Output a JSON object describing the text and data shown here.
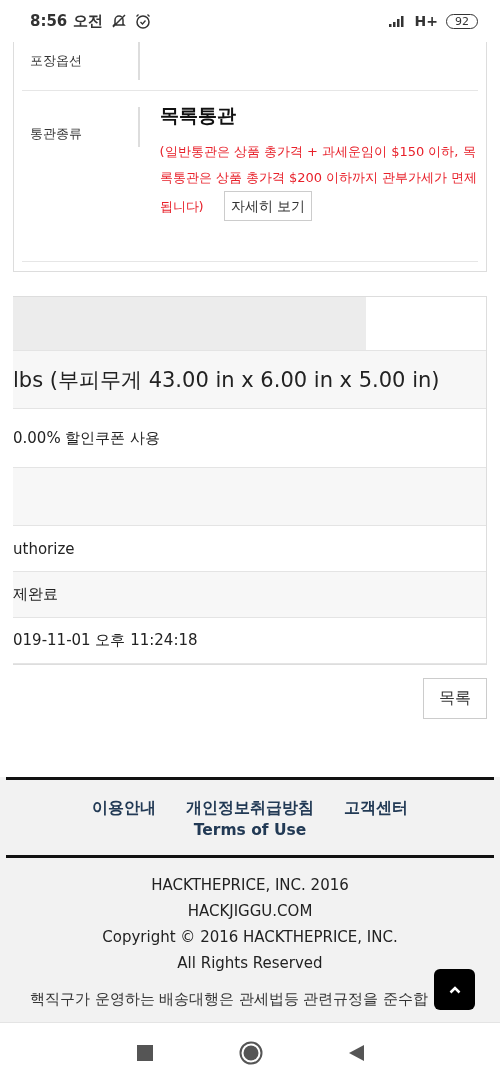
{
  "status_bar": {
    "time": "8:56 오전",
    "network": "H+",
    "battery": "92"
  },
  "customs_card": {
    "rows": [
      {
        "kind": "empty",
        "label": "포장옵션"
      },
      {
        "kind": "customs",
        "label": "통관종류",
        "value": "목록통관",
        "note": "(일반통관은 상품 총가격 + 과세운임이 $150 이하, 목록통관은 상품 총가격 $200 이하까지 관부가세가 면제됩니다)",
        "button": "자세히 보기"
      }
    ]
  },
  "detail_table": {
    "rows": [
      {
        "kind": "header",
        "text": ""
      },
      {
        "kind": "large",
        "text": "lbs (부피무게 43.00 in x 6.00 in x 5.00 in)"
      },
      {
        "kind": "normal",
        "text": "0.00% 할인쿠폰 사용"
      },
      {
        "kind": "normal",
        "text": ""
      },
      {
        "kind": "normal",
        "text": "uthorize"
      },
      {
        "kind": "normal",
        "text": "제완료"
      },
      {
        "kind": "normal",
        "text": "019-11-01 오후 11:24:18"
      }
    ]
  },
  "list_button": "목록",
  "footer": {
    "links": [
      "이용안내",
      "개인정보취급방침",
      "고객센터",
      "Terms of Use"
    ],
    "company_lines": [
      "HACKTHEPRICE, INC. 2016",
      "HACKJIGGU.COM",
      "Copyright © 2016 HACKTHEPRICE, INC.",
      "All Rights Reserved"
    ],
    "notice": "핵직구가 운영하는 배송대행은 관세법등 관련규정을 준수합"
  }
}
